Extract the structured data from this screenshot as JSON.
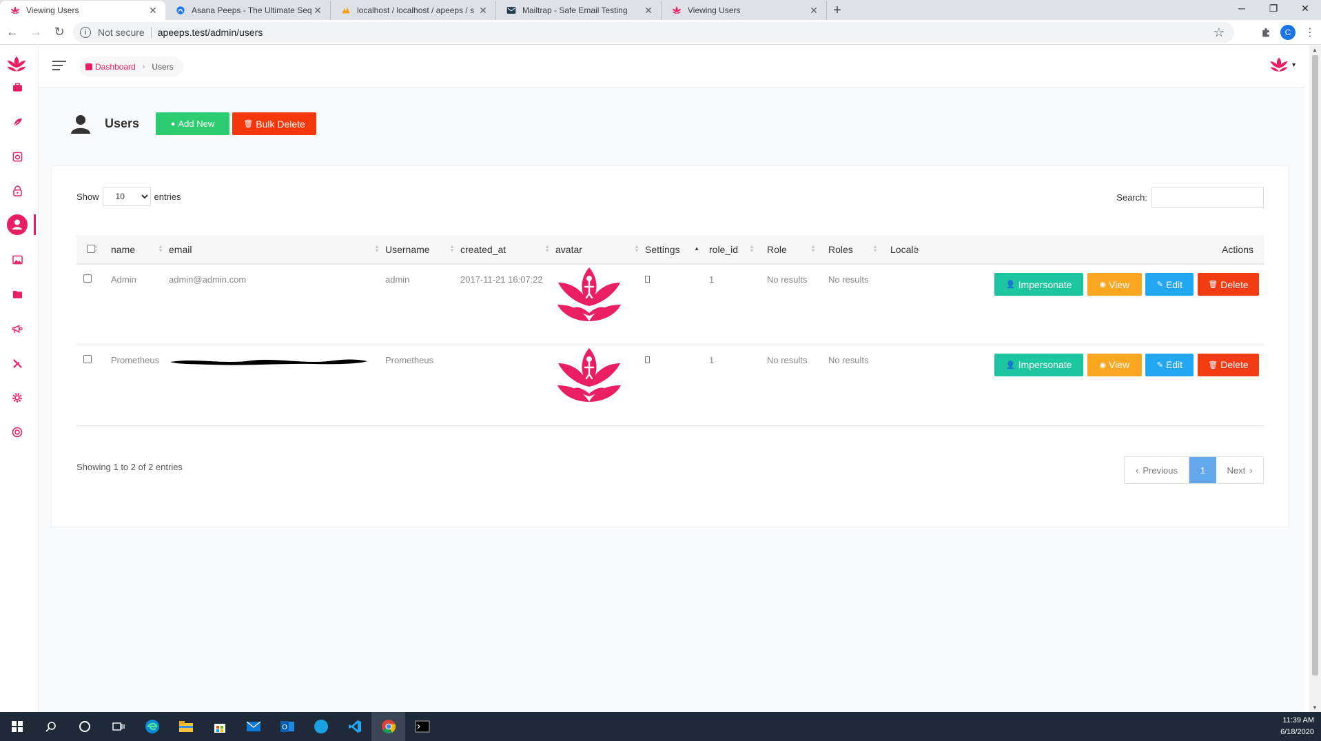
{
  "browser": {
    "tabs": [
      {
        "title": "Viewing Users",
        "active": true
      },
      {
        "title": "Asana Peeps - The Ultimate Sequ",
        "active": false
      },
      {
        "title": "localhost / localhost / apeeps / s",
        "active": false
      },
      {
        "title": "Mailtrap - Safe Email Testing",
        "active": false
      },
      {
        "title": "Viewing Users",
        "active": false
      }
    ],
    "new_tab": "+",
    "security_label": "Not secure",
    "url": "apeeps.test/admin/users",
    "profile_initial": "C"
  },
  "breadcrumb": {
    "home": "Dashboard",
    "current": "Users"
  },
  "page": {
    "title": "Users",
    "add_new_label": "Add New",
    "bulk_delete_label": "Bulk Delete"
  },
  "table_controls": {
    "show_label": "Show",
    "entries_label": "entries",
    "page_length": "10",
    "search_label": "Search:"
  },
  "table": {
    "columns": [
      "name",
      "email",
      "Username",
      "created_at",
      "avatar",
      "Settings",
      "role_id",
      "Role",
      "Roles",
      "Locale",
      "Actions"
    ],
    "rows": [
      {
        "name": "Admin",
        "email": "admin@admin.com",
        "username": "admin",
        "created_at": "2017-11-21 16:07:22",
        "role_id": "1",
        "role": "No results",
        "roles": "No results",
        "locale": ""
      },
      {
        "name": "Prometheus",
        "email": "",
        "username": "Prometheus",
        "created_at": "",
        "role_id": "1",
        "role": "No results",
        "roles": "No results",
        "locale": ""
      }
    ],
    "action_labels": {
      "impersonate": "Impersonate",
      "view": "View",
      "edit": "Edit",
      "delete": "Delete"
    }
  },
  "footer": {
    "info": "Showing 1 to 2 of 2 entries",
    "previous": "Previous",
    "current_page": "1",
    "next": "Next"
  },
  "clock": {
    "time": "11:39 AM",
    "date": "6/18/2020"
  },
  "colors": {
    "brand": "#e91e63",
    "add": "#2ecc71",
    "delete": "#f23c14",
    "impersonate": "#1ec6a0",
    "view": "#f9a620",
    "edit": "#22a7f0",
    "page_active": "#62a8ea"
  },
  "sidebar_icons": [
    "briefcase-icon",
    "leaf-icon",
    "camera-icon",
    "lock-icon",
    "user-icon",
    "image-icon",
    "folder-icon",
    "megaphone-icon",
    "tools-icon",
    "gear-icon",
    "support-icon"
  ]
}
